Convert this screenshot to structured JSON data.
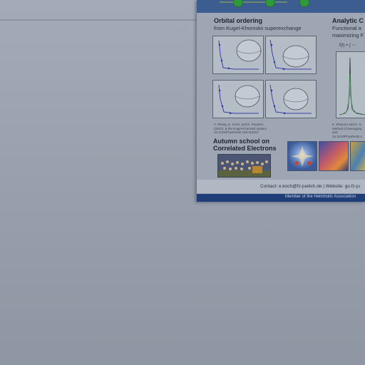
{
  "poster": {
    "orbital": {
      "title": "Orbital ordering",
      "subtitle": "from Kugel-Khomskii superexchange",
      "citation_line1": "Y. Zhang, E. Koch, and E. Pavarini",
      "citation_line2": "(2021): & the Kugel-Khomskii system",
      "citation_line3": "10.1103/PhysRevB.106.115110"
    },
    "analytic": {
      "title": "Analytic C",
      "subtitle_line1": "Functional a",
      "subtitle_line2": "maximizing F",
      "citation_line1": "K. Zhavoro and E. S.",
      "citation_line2": "Method of averaging and",
      "citation_line3": "10.1103/PhysRevB.1"
    },
    "school": {
      "title_line1": "Autumn school on",
      "title_line2": "Correlated Electrons"
    },
    "contact": "Contact: e.koch@fz-juelich.de | Website: go.fz-ju",
    "footer": "Member of the Helmholtz Association"
  },
  "colors": {
    "background": "#9ea6b3",
    "poster_header": "#3c5d8f",
    "footer_bar": "#1f3d78",
    "accent_green": "#2e9b3b"
  }
}
